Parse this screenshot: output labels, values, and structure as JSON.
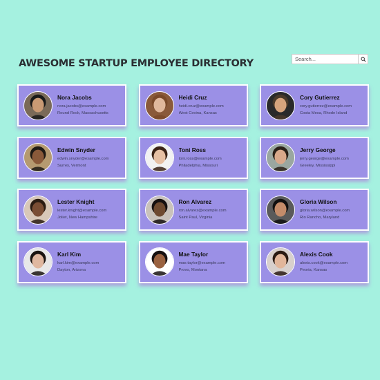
{
  "header": {
    "title": "AWESOME STARTUP EMPLOYEE DIRECTORY"
  },
  "search": {
    "placeholder": "Search...",
    "button_icon": "search-icon"
  },
  "colors": {
    "background": "#a5f1e0",
    "card": "#9b90e6",
    "card_border": "#ffffff",
    "shadow": "#b060d8"
  },
  "employees": [
    {
      "name": "Nora Jacobs",
      "email": "nora.jacobs@example.com",
      "location": "Round Rock, Massachusetts",
      "skin": "#c99a74",
      "hair": "#1a1a1a",
      "bg": "#7a6a58"
    },
    {
      "name": "Heidi Cruz",
      "email": "heidi.cruz@example.com",
      "location": "West Covina, Kansas",
      "skin": "#e0b89c",
      "hair": "#7a4a2a",
      "bg": "#8a5a3a"
    },
    {
      "name": "Cory Gutierrez",
      "email": "cory.gutierrez@example.com",
      "location": "Costa Mesa, Rhode Island",
      "skin": "#d6a47c",
      "hair": "#4a3a2a",
      "bg": "#2a2a2a"
    },
    {
      "name": "Edwin Snyder",
      "email": "edwin.snyder@example.com",
      "location": "Surrey, Vermont",
      "skin": "#8a5a3a",
      "hair": "#1f1a14",
      "bg": "#b59a70"
    },
    {
      "name": "Toni Ross",
      "email": "toni.ross@example.com",
      "location": "Philadelphia, Missouri",
      "skin": "#e6c0a4",
      "hair": "#3a2216",
      "bg": "#f2f2f2"
    },
    {
      "name": "Jerry George",
      "email": "jerry.george@example.com",
      "location": "Greeley, Mississippi",
      "skin": "#d9a88a",
      "hair": "#2a2018",
      "bg": "#9aa7a0"
    },
    {
      "name": "Lester Knight",
      "email": "lester.knight@example.com",
      "location": "Joliet, New Hampshire",
      "skin": "#7a4e34",
      "hair": "#2a1c12",
      "bg": "#d8c8b8"
    },
    {
      "name": "Ron Alvarez",
      "email": "ron.alvarez@example.com",
      "location": "Saint Paul, Virginia",
      "skin": "#6e4a30",
      "hair": "#151010",
      "bg": "#c9c2ba"
    },
    {
      "name": "Gloria Wilson",
      "email": "gloria.wilson@example.com",
      "location": "Rio Rancho, Maryland",
      "skin": "#c48c6a",
      "hair": "#101010",
      "bg": "#5a5a5a"
    },
    {
      "name": "Karl Kim",
      "email": "karl.kim@example.com",
      "location": "Dayton, Arizona",
      "skin": "#e0b8a0",
      "hair": "#1a1410",
      "bg": "#e8e8e8"
    },
    {
      "name": "Mae Taylor",
      "email": "mae.taylor@example.com",
      "location": "Provo, Montana",
      "skin": "#9a6240",
      "hair": "#161010",
      "bg": "#ffffff"
    },
    {
      "name": "Alexis Cook",
      "email": "alexis.cook@example.com",
      "location": "Peoria, Kansas",
      "skin": "#e2b69a",
      "hair": "#2a1a12",
      "bg": "#d8d0cc"
    }
  ]
}
